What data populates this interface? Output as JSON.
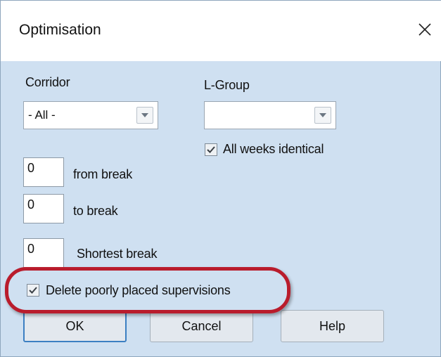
{
  "dialog": {
    "title": "Optimisation",
    "close_icon": "close-icon"
  },
  "corridor": {
    "label": "Corridor",
    "value": "- All -"
  },
  "lgroup": {
    "label": "L-Group",
    "value": ""
  },
  "all_weeks": {
    "label": "All weeks identical",
    "checked": true
  },
  "from_break": {
    "value": "0",
    "label": "from break"
  },
  "to_break": {
    "value": "0",
    "label": "to break"
  },
  "shortest_break": {
    "value": "0",
    "label": "Shortest break"
  },
  "delete_poorly": {
    "label": "Delete poorly placed supervisions",
    "checked": true
  },
  "buttons": {
    "ok": "OK",
    "cancel": "Cancel",
    "help": "Help"
  },
  "colors": {
    "dialog_bg": "#cfe0f1",
    "highlight": "#b91c2c"
  }
}
